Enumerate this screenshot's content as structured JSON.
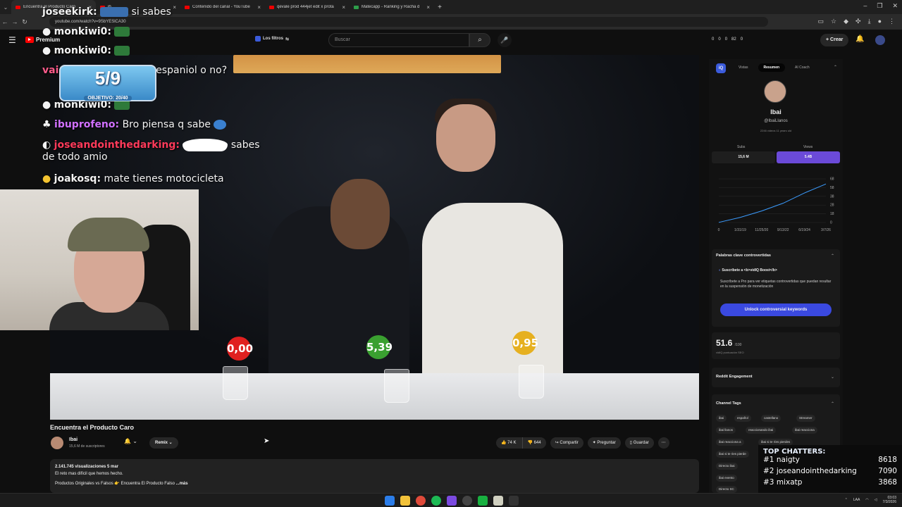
{
  "browser": {
    "tabs": [
      {
        "label": "Encuentra el Producto Caro",
        "active": true
      },
      {
        "label": "jb",
        "active": false
      },
      {
        "label": "Contenido del canal - YouTube",
        "active": false
      },
      {
        "label": "qevale prod 444jet edit x prota",
        "active": false
      },
      {
        "label": "Matecapp - Ranking y Racha d",
        "active": false
      }
    ],
    "url": "youtube.com/watch?v=9SbYESlCA30"
  },
  "yt_header": {
    "logo": "Premium",
    "filters_label": "Los filtros",
    "search_placeholder": "Buscar",
    "stats": [
      "0",
      "0",
      "0",
      "82",
      "0"
    ],
    "create_label": "Crear"
  },
  "stream_overlay": {
    "chat": [
      {
        "user": "joseekirk:",
        "msg": "si sabes",
        "user_color": "#f3f3f3"
      },
      {
        "user": "monkiwi0:",
        "msg": "",
        "user_color": "#f3f3f3"
      },
      {
        "user": "monkiwi0:",
        "msg": "",
        "user_color": "#f3f3f3"
      },
      {
        "user": "vai",
        "msg": "te que preferis ser espaniol o no?",
        "user_color": "#ff5b8a"
      },
      {
        "user": "monkiwi0:",
        "msg": "",
        "user_color": "#f3f3f3"
      },
      {
        "user": "ibuprofeno:",
        "msg": "Bro piensa q sabe",
        "user_color": "#d070ff"
      },
      {
        "user": "joseandointhedarking:",
        "msg": "sabes de todo amio",
        "user_color": "#ff3a5a"
      },
      {
        "user": "joakosq:",
        "msg": "mate tienes motocicleta",
        "user_color": "#f3f3f3"
      }
    ],
    "goal": {
      "count": "5/9",
      "objective": "OBJETIVO: 20/40"
    }
  },
  "video": {
    "price_tags": [
      "0,00",
      "5,39",
      "0,95"
    ],
    "title": "Encuentra el Producto Caro",
    "channel": {
      "name": "Ibai",
      "subs": "15,6 M de suscriptores"
    },
    "remix_label": "Remix",
    "actions": {
      "likes": "74 K",
      "dislikes": "644",
      "share": "Compartir",
      "ask": "Preguntar",
      "save": "Guardar"
    },
    "description": {
      "stats": "2.141.745 visualizaciones  5 mar",
      "line1": "El reto mas difícil que hemos hecho.",
      "line2": "Productos Originales vs Falsos",
      "line3": "Encuentra El Producto Falso",
      "more": "...más"
    }
  },
  "vidiq": {
    "tabs": [
      "Vistas",
      "Resumen",
      "AI Coach"
    ],
    "channel_name": "Ibai",
    "handle": "@IbaiLlanos",
    "meta": "2246 videos   11 years old",
    "subs_label": "Subs",
    "subs_value": "15,6 M",
    "views_label": "Views",
    "views_value": "5.4B",
    "sections": {
      "controversial": "Palabras clave controvertidas",
      "boost_title": "Suscríbete a <b>vidIQ Boost</b>",
      "boost_desc": "Suscríbete a Pro para ver etiquetas controvertidas que puedan resultar en la suspensión de monetización",
      "unlock_btn": "Unlock controversial keywords",
      "seo_score": "51.6",
      "seo_of": "/100",
      "seo_label": "vidIQ puntuación SEO",
      "reddit": "Reddit Engagement",
      "channel_tags": "Channel Tags"
    },
    "tags": [
      "ibai",
      "español",
      "castellano",
      "Streamer",
      "ibai llanos",
      "reaccionando ibai",
      "ibai reacciona",
      "ibai reacciona a",
      "ibai si te ríes pierdes",
      "ibai si te ries pierde",
      "Directo ibai",
      "ibai evento",
      "Directo SC"
    ]
  },
  "chart_data": {
    "type": "line",
    "title": "",
    "x": [
      "1/31/19",
      "11/25/20",
      "9/13/22",
      "6/19/24",
      "3/7/26"
    ],
    "series": [
      {
        "values": [
          0.2,
          8,
          18,
          30,
          46,
          60
        ]
      }
    ],
    "y_ticks": [
      "0",
      "18",
      "28",
      "38",
      "58",
      "68"
    ],
    "ylim": [
      0,
      68
    ]
  },
  "top_chatters": {
    "title": "TOP CHATTERS:",
    "entries": [
      {
        "rank": "#1",
        "name": "naigty",
        "count": "8618"
      },
      {
        "rank": "#2",
        "name": "joseandointhedarking",
        "count": "7090"
      },
      {
        "rank": "#3",
        "name": "mixatp",
        "count": "3868"
      }
    ]
  },
  "taskbar": {
    "lang": "LAA",
    "time": "03:03",
    "date": "7/3/2026"
  }
}
